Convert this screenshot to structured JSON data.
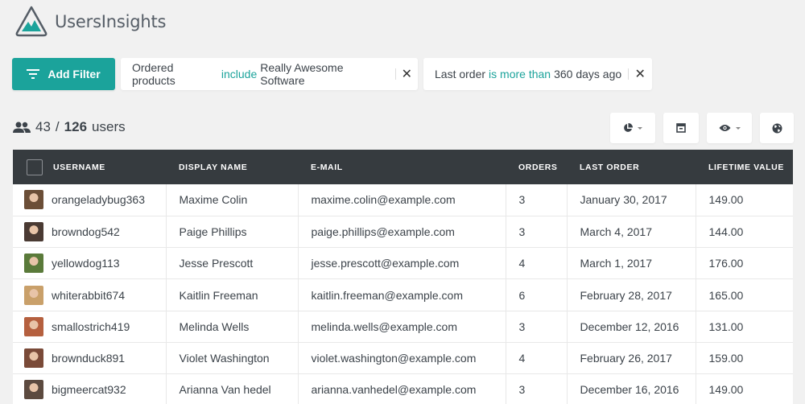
{
  "app": {
    "title": "UsersInsights",
    "brand_color": "#1ba39b",
    "logo_icon": "mountain-logo-icon"
  },
  "filters": {
    "add_filter_label": "Add Filter",
    "add_filter_icon": "filter-lines-icon",
    "active": [
      {
        "field": "Ordered products",
        "operator": "include",
        "value": "Really Awesome Software"
      },
      {
        "field": "Last order",
        "operator": "is more than",
        "value": "360 days ago"
      }
    ],
    "remove_icon": "close-icon"
  },
  "summary": {
    "icon": "users-icon",
    "filtered_count": "43",
    "separator": "/",
    "total_count": "126",
    "unit": "users"
  },
  "toolbar": [
    {
      "name": "segments-button",
      "icon": "pie-chart-icon",
      "has_dropdown": true
    },
    {
      "name": "export-button",
      "icon": "export-box-icon",
      "has_dropdown": false
    },
    {
      "name": "columns-button",
      "icon": "eye-icon",
      "has_dropdown": true
    },
    {
      "name": "map-button",
      "icon": "globe-icon",
      "has_dropdown": false
    }
  ],
  "table": {
    "columns": [
      "USERNAME",
      "DISPLAY NAME",
      "E-MAIL",
      "ORDERS",
      "LAST ORDER",
      "LIFETIME VALUE"
    ],
    "rows": [
      {
        "username": "orangeladybug363",
        "display_name": "Maxime Colin",
        "email": "maxime.colin@example.com",
        "orders": "3",
        "last_order": "January 30, 2017",
        "lifetime_value": "149.00",
        "avatar_color": "#6b4e37"
      },
      {
        "username": "browndog542",
        "display_name": "Paige Phillips",
        "email": "paige.phillips@example.com",
        "orders": "3",
        "last_order": "March 4, 2017",
        "lifetime_value": "144.00",
        "avatar_color": "#4a3a33"
      },
      {
        "username": "yellowdog113",
        "display_name": "Jesse Prescott",
        "email": "jesse.prescott@example.com",
        "orders": "4",
        "last_order": "March 1, 2017",
        "lifetime_value": "176.00",
        "avatar_color": "#5a7a3a"
      },
      {
        "username": "whiterabbit674",
        "display_name": "Kaitlin Freeman",
        "email": "kaitlin.freeman@example.com",
        "orders": "6",
        "last_order": "February 28, 2017",
        "lifetime_value": "165.00",
        "avatar_color": "#c9a06a"
      },
      {
        "username": "smallostrich419",
        "display_name": "Melinda Wells",
        "email": "melinda.wells@example.com",
        "orders": "3",
        "last_order": "December 12, 2016",
        "lifetime_value": "131.00",
        "avatar_color": "#b5603f"
      },
      {
        "username": "brownduck891",
        "display_name": "Violet Washington",
        "email": "violet.washington@example.com",
        "orders": "4",
        "last_order": "February 26, 2017",
        "lifetime_value": "159.00",
        "avatar_color": "#7a4a38"
      },
      {
        "username": "bigmeercat932",
        "display_name": "Arianna Van hedel",
        "email": "arianna.vanhedel@example.com",
        "orders": "3",
        "last_order": "December 16, 2016",
        "lifetime_value": "149.00",
        "avatar_color": "#5c4a3f"
      }
    ]
  }
}
